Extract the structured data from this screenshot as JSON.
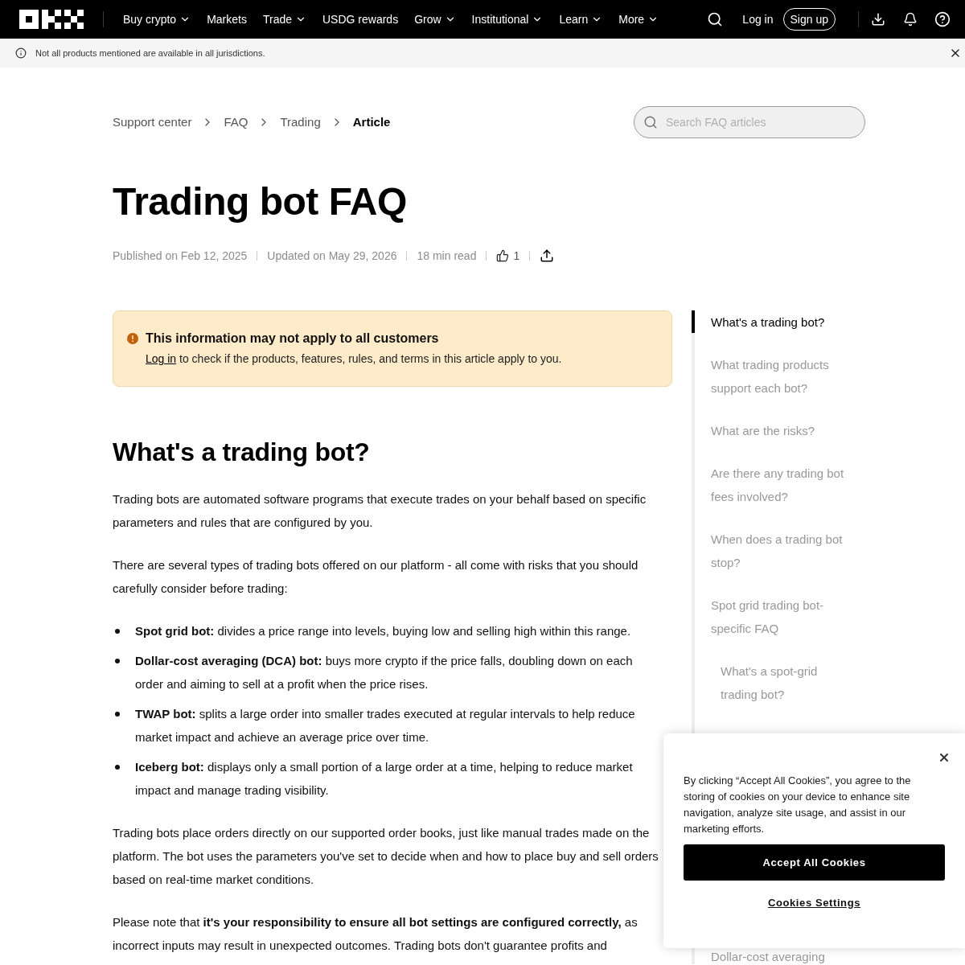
{
  "nav": {
    "menu": [
      {
        "label": "Buy crypto",
        "has_menu": true
      },
      {
        "label": "Markets",
        "has_menu": false
      },
      {
        "label": "Trade",
        "has_menu": true
      },
      {
        "label": "USDG rewards",
        "has_menu": false
      },
      {
        "label": "Grow",
        "has_menu": true
      },
      {
        "label": "Institutional",
        "has_menu": true
      },
      {
        "label": "Learn",
        "has_menu": true
      },
      {
        "label": "More",
        "has_menu": true
      }
    ],
    "login": "Log in",
    "signup": "Sign up"
  },
  "notice_bar": {
    "text": "Not all products mentioned are available in all jurisdictions."
  },
  "breadcrumb": [
    {
      "label": "Support center",
      "current": false
    },
    {
      "label": "FAQ",
      "current": false
    },
    {
      "label": "Trading",
      "current": false
    },
    {
      "label": "Article",
      "current": true
    }
  ],
  "search": {
    "placeholder": "Search FAQ articles"
  },
  "article": {
    "title": "Trading bot FAQ",
    "meta": {
      "published": "Published on Feb 12, 2025",
      "updated": "Updated on May 29, 2026",
      "read_time": "18 min read",
      "likes": "1"
    },
    "alert": {
      "title": "This information may not apply to all customers",
      "link": "Log in",
      "text": "to check if the products, features, rules, and terms in this article apply to you."
    },
    "heading": "What's a trading bot?",
    "blocks": [
      {
        "kind": "paragraph",
        "text": "Trading bots are automated software programs that execute trades on your behalf based on specific parameters and rules that are configured by you."
      },
      {
        "kind": "paragraph",
        "text": "There are several types of trading bots offered on our platform - all come with risks that you should carefully consider before trading:"
      },
      {
        "kind": "bullets",
        "items": [
          "**Spot grid bot:** divides a price range into levels, buying low and selling high within this range.",
          "**Dollar-cost averaging (DCA) bot:** buys more crypto if the price falls, doubling down on each order and aiming to sell at a profit when the price rises.",
          "**TWAP bot:** splits a large order into smaller trades executed at regular intervals to help reduce market impact and achieve an average price over time.",
          "**Iceberg bot:** displays only a small portion of a large order at a time, helping to reduce market impact and manage trading visibility."
        ]
      },
      {
        "kind": "paragraph",
        "text": "Trading bots place orders directly on our supported order books, just like manual trades made on the platform. The bot uses the parameters you've set to decide when and how to place buy and sell orders based on real-time market conditions."
      },
      {
        "kind": "paragraph",
        "text": "Please note that **it's your responsibility to ensure all bot settings are configured correctly,** as incorrect inputs may result in unexpected outcomes. Trading bots don't guarantee profits and"
      }
    ]
  },
  "toc": [
    {
      "label": "What's a trading bot?",
      "selected": true
    },
    {
      "label": "What trading products support each bot?",
      "selected": false
    },
    {
      "label": "What are the risks?",
      "selected": false
    },
    {
      "label": "Are there any trading bot fees involved?",
      "selected": false
    },
    {
      "label": "When does a trading bot stop?",
      "selected": false
    },
    {
      "label": "Spot grid trading bot-specific FAQ",
      "selected": false,
      "children": [
        {
          "label": "What's a spot-grid trading bot?",
          "selected": false
        }
      ]
    },
    {
      "label": "Dollar-cost averaging",
      "selected": false
    }
  ],
  "cookie_banner": {
    "text": "By clicking “Accept All Cookies”, you agree to the storing of cookies on your device to enhance site navigation, analyze site usage, and assist in our marketing efforts.",
    "accept": "Accept All Cookies",
    "settings": "Cookies Settings"
  }
}
